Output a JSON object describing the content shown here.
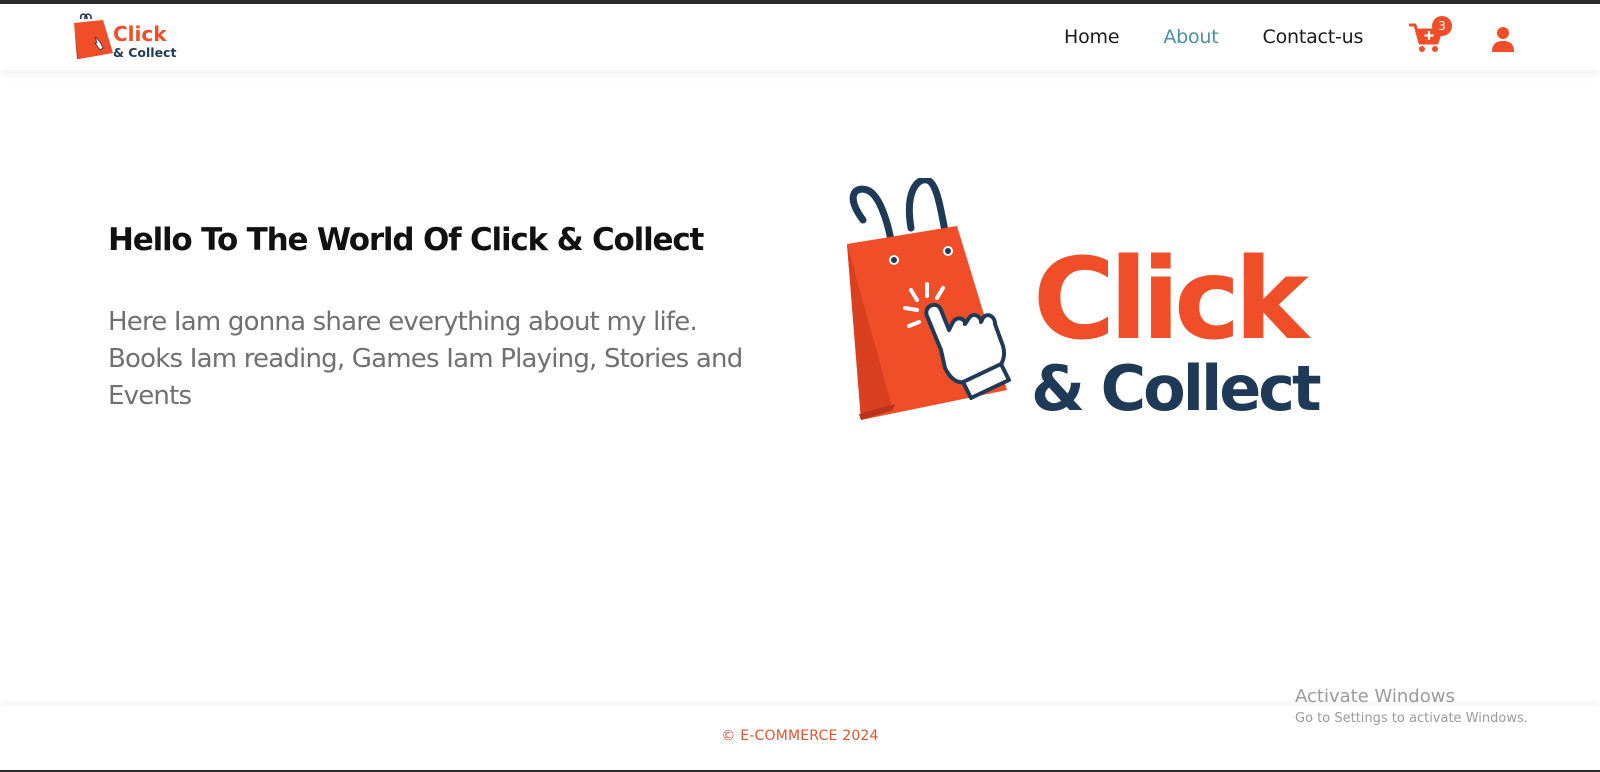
{
  "brand": {
    "word1": "Click",
    "word2": "& Collect",
    "colors": {
      "orange": "#f04e29",
      "navy": "#1f3a56"
    }
  },
  "nav": {
    "links": [
      {
        "label": "Home",
        "active": false
      },
      {
        "label": "About",
        "active": true
      },
      {
        "label": "Contact-us",
        "active": false
      }
    ],
    "cart_count": "3",
    "cart_icon": "cart-plus-icon",
    "user_icon": "user-icon",
    "active_color": "#4a8fa3"
  },
  "hero": {
    "title": "Hello To The World Of Click & Collect",
    "text": "Here Iam gonna share everything about my life. Books Iam reading, Games Iam Playing, Stories and Events"
  },
  "footer": {
    "copyright": "© E-COMMERCE 2024"
  },
  "os_overlay": {
    "title": "Activate Windows",
    "subtitle": "Go to Settings to activate Windows."
  }
}
